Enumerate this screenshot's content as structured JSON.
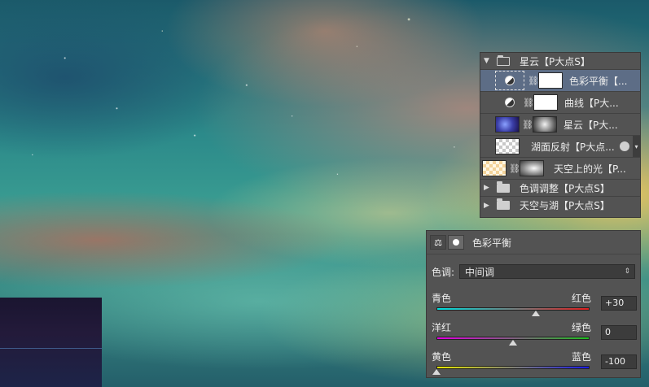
{
  "layers": {
    "items": [
      {
        "type": "group",
        "expanded": true,
        "label": "星云【P大点S】"
      },
      {
        "type": "adjustment",
        "label": "色彩平衡【...",
        "selected": true
      },
      {
        "type": "adjustment",
        "label": "曲线【P大..."
      },
      {
        "type": "image",
        "label": "星云【P大..."
      },
      {
        "type": "image",
        "label": "湖面反射【P大点..."
      },
      {
        "type": "image",
        "label": "天空上的光【P..."
      },
      {
        "type": "group",
        "expanded": false,
        "label": "色调调整【P大点S】"
      },
      {
        "type": "group",
        "expanded": false,
        "label": "天空与湖【P大点S】"
      }
    ]
  },
  "properties": {
    "title": "色彩平衡",
    "tone_label": "色调:",
    "tone_value": "中间调",
    "sliders": [
      {
        "left": "青色",
        "right": "红色",
        "value": "+30",
        "fraction": 0.65,
        "gradient": "linear-gradient(90deg,#00e0e0,#e22020)"
      },
      {
        "left": "洋红",
        "right": "绿色",
        "value": "0",
        "fraction": 0.5,
        "gradient": "linear-gradient(90deg,#e000e0,#20c020)"
      },
      {
        "left": "黄色",
        "right": "蓝色",
        "value": "-100",
        "fraction": 0.0,
        "gradient": "linear-gradient(90deg,#e8e800,#1a1ae8)"
      }
    ]
  },
  "colors": {
    "panel_bg": "#535353",
    "selection_bg": "#5d6d86"
  }
}
